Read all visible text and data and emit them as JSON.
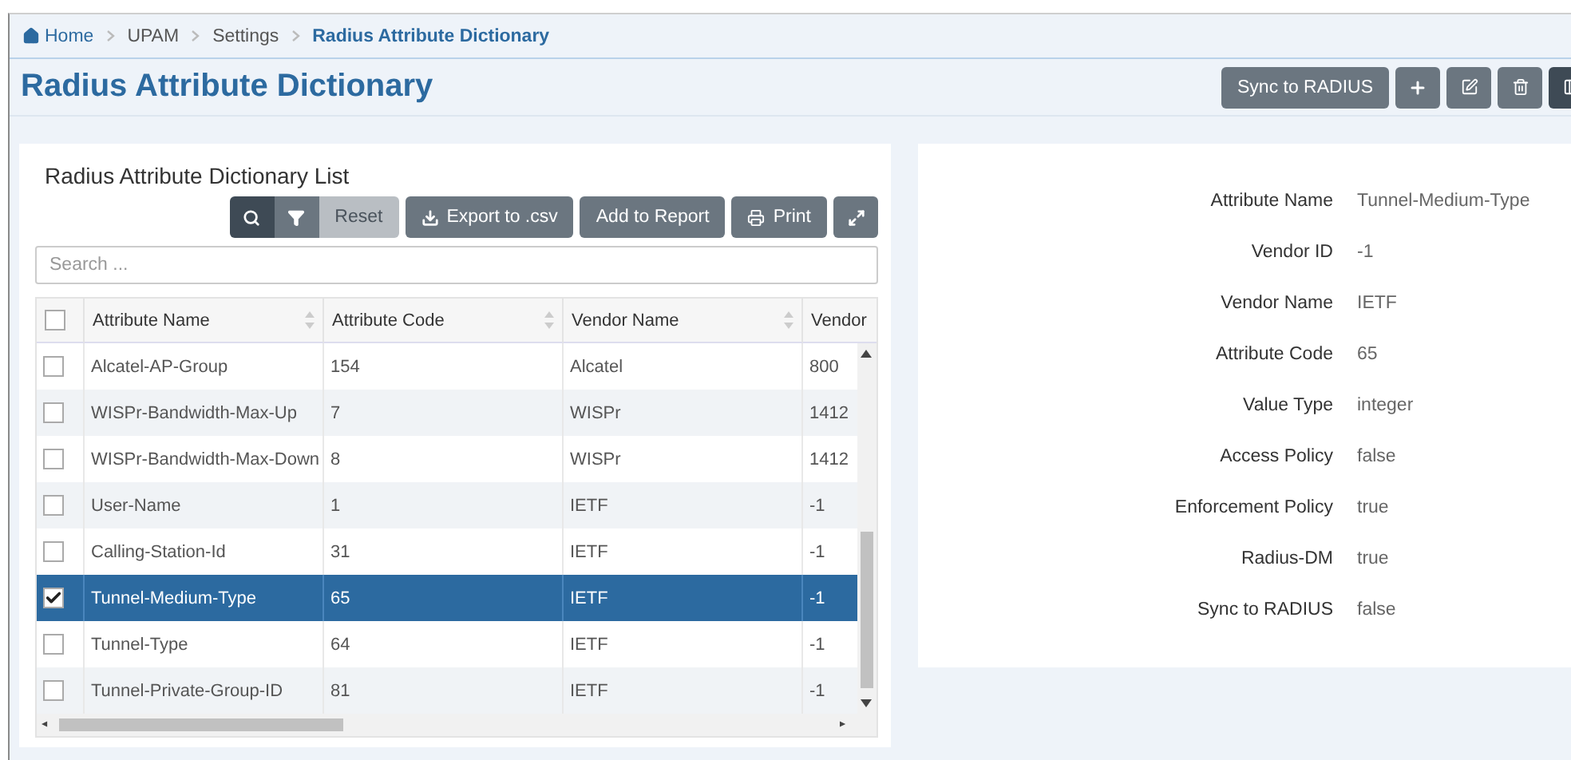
{
  "breadcrumb": [
    {
      "label": "Home",
      "selected": false
    },
    {
      "label": "UPAM",
      "selected": false
    },
    {
      "label": "Settings",
      "selected": false
    },
    {
      "label": "Radius Attribute Dictionary",
      "selected": true
    }
  ],
  "page_title": "Radius Attribute Dictionary",
  "header_actions": [
    {
      "kind": "text",
      "label": "Sync to RADIUS"
    },
    {
      "kind": "add"
    },
    {
      "kind": "edit"
    },
    {
      "kind": "delete"
    },
    {
      "kind": "columns"
    }
  ],
  "list": {
    "title": "Radius Attribute Dictionary List",
    "toolbar": [
      {
        "kind": "search"
      },
      {
        "kind": "filter"
      },
      {
        "kind": "reset",
        "label": "Reset",
        "disabled": true
      },
      {
        "kind": "export",
        "label": "Export to .csv"
      },
      {
        "kind": "report",
        "label": "Add to Report"
      },
      {
        "kind": "print",
        "label": "Print"
      },
      {
        "kind": "expand"
      }
    ],
    "search": {
      "placeholder": "Search ..."
    },
    "columns": [
      {
        "label": "Attribute Name"
      },
      {
        "label": "Attribute Code"
      },
      {
        "label": "Vendor Name"
      },
      {
        "label": "Vendor"
      }
    ],
    "header_checked": false,
    "rows": [
      {
        "cells": [
          "Alcatel-AP-Group",
          "154",
          "Alcatel",
          "800"
        ],
        "checked": false,
        "selected": false
      },
      {
        "cells": [
          "WISPr-Bandwidth-Max-Up",
          "7",
          "WISPr",
          "1412"
        ],
        "checked": false,
        "selected": false
      },
      {
        "cells": [
          "WISPr-Bandwidth-Max-Down",
          "8",
          "WISPr",
          "1412"
        ],
        "checked": false,
        "selected": false
      },
      {
        "cells": [
          "User-Name",
          "1",
          "IETF",
          "-1"
        ],
        "checked": false,
        "selected": false
      },
      {
        "cells": [
          "Calling-Station-Id",
          "31",
          "IETF",
          "-1"
        ],
        "checked": false,
        "selected": false
      },
      {
        "cells": [
          "Tunnel-Medium-Type",
          "65",
          "IETF",
          "-1"
        ],
        "checked": true,
        "selected": true
      },
      {
        "cells": [
          "Tunnel-Type",
          "64",
          "IETF",
          "-1"
        ],
        "checked": false,
        "selected": false
      },
      {
        "cells": [
          "Tunnel-Private-Group-ID",
          "81",
          "IETF",
          "-1"
        ],
        "checked": false,
        "selected": false
      }
    ]
  },
  "details": [
    {
      "label": "Attribute Name",
      "value": "Tunnel-Medium-Type"
    },
    {
      "label": "Vendor ID",
      "value": "-1"
    },
    {
      "label": "Vendor Name",
      "value": "IETF"
    },
    {
      "label": "Attribute Code",
      "value": "65"
    },
    {
      "label": "Value Type",
      "value": "integer"
    },
    {
      "label": "Access Policy",
      "value": "false"
    },
    {
      "label": "Enforcement Policy",
      "value": "true"
    },
    {
      "label": "Radius-DM",
      "value": "true"
    },
    {
      "label": "Sync to RADIUS",
      "value": "false"
    }
  ]
}
